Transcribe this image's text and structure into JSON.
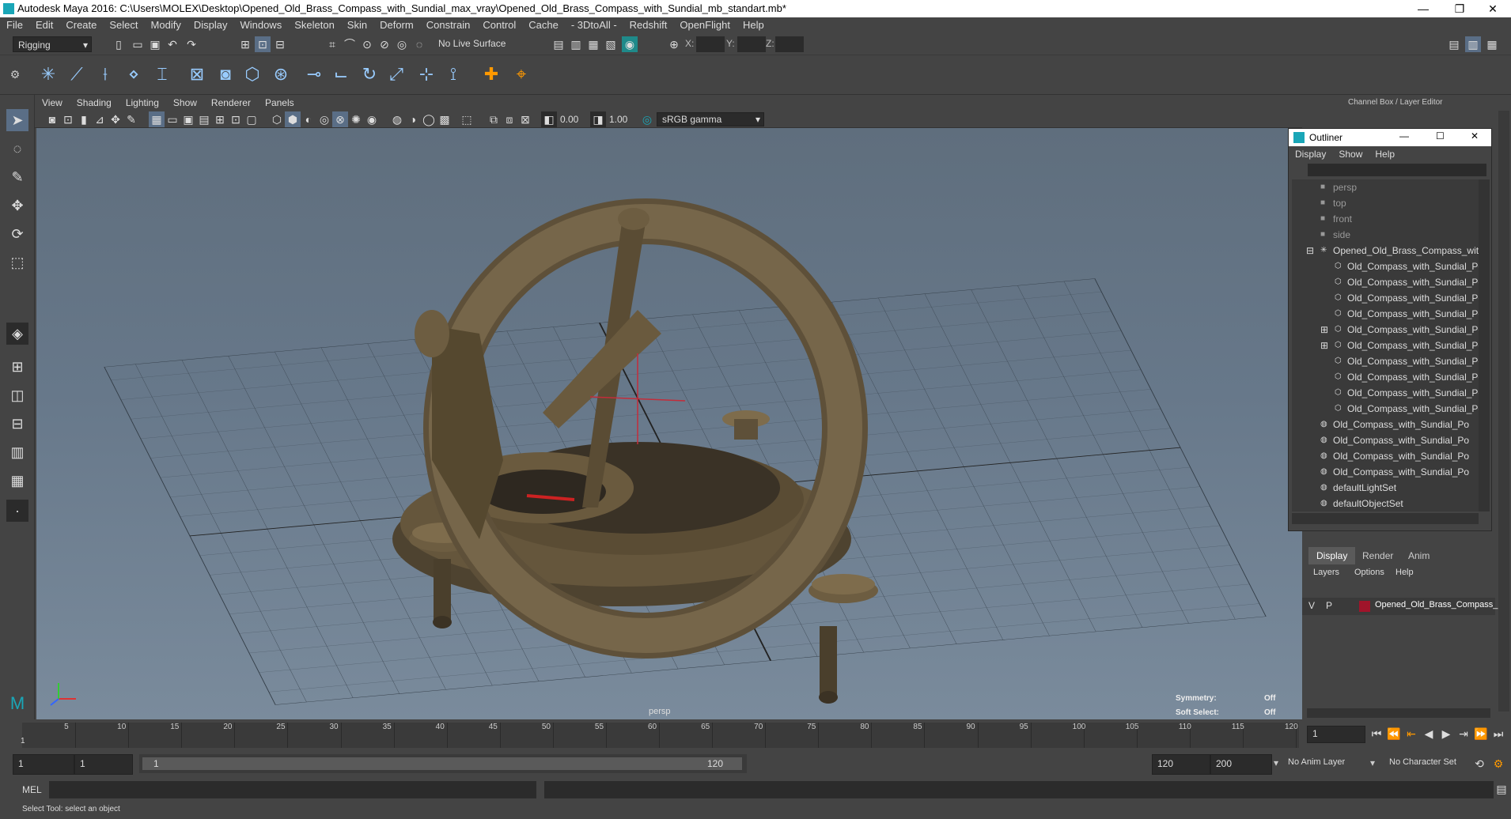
{
  "window": {
    "title": "Autodesk Maya 2016: C:\\Users\\MOLEX\\Desktop\\Opened_Old_Brass_Compass_with_Sundial_max_vray\\Opened_Old_Brass_Compass_with_Sundial_mb_standart.mb*",
    "controls": [
      "—",
      "❐",
      "✕"
    ]
  },
  "menubar": [
    "File",
    "Edit",
    "Create",
    "Select",
    "Modify",
    "Display",
    "Windows",
    "Skeleton",
    "Skin",
    "Deform",
    "Constrain",
    "Control",
    "Cache",
    "- 3DtoAll -",
    "Redshift",
    "OpenFlight",
    "Help"
  ],
  "toolbar": {
    "mode": "Rigging",
    "live_surface": "No Live Surface",
    "x_label": "X:",
    "y_label": "Y:",
    "z_label": "Z:"
  },
  "panel_menu": [
    "View",
    "Shading",
    "Lighting",
    "Show",
    "Renderer",
    "Panels"
  ],
  "panel_tools": {
    "exposure": "0.00",
    "gamma": "1.00",
    "color_space": "sRGB gamma"
  },
  "viewport": {
    "camera": "persp",
    "symmetry_label": "Symmetry:",
    "symmetry_value": "Off",
    "soft_select_label": "Soft Select:",
    "soft_select_value": "Off"
  },
  "channel_box_label": "Channel Box / Layer Editor",
  "outliner": {
    "title": "Outliner",
    "menu": [
      "Display",
      "Show",
      "Help"
    ],
    "items": [
      {
        "label": "persp",
        "dim": true
      },
      {
        "label": "top",
        "dim": true
      },
      {
        "label": "front",
        "dim": true
      },
      {
        "label": "side",
        "dim": true
      },
      {
        "label": "Opened_Old_Brass_Compass_with",
        "dim": false
      },
      {
        "label": "Old_Compass_with_Sundial_Po",
        "dim": false
      },
      {
        "label": "Old_Compass_with_Sundial_Po",
        "dim": false
      },
      {
        "label": "Old_Compass_with_Sundial_Po",
        "dim": false
      },
      {
        "label": "Old_Compass_with_Sundial_Po",
        "dim": false
      },
      {
        "label": "Old_Compass_with_Sundial_Po",
        "dim": false
      },
      {
        "label": "Old_Compass_with_Sundial_Po",
        "dim": false
      },
      {
        "label": "Old_Compass_with_Sundial_Po",
        "dim": false
      },
      {
        "label": "Old_Compass_with_Sundial_Po",
        "dim": false
      },
      {
        "label": "Old_Compass_with_Sundial_Po",
        "dim": false
      },
      {
        "label": "Old_Compass_with_Sundial_Po",
        "dim": false
      },
      {
        "label": "Old_Compass_with_Sundial_Po",
        "dim": false
      },
      {
        "label": "Old_Compass_with_Sundial_Po",
        "dim": false
      },
      {
        "label": "Old_Compass_with_Sundial_Po",
        "dim": false
      },
      {
        "label": "Old_Compass_with_Sundial_Po",
        "dim": false
      },
      {
        "label": "defaultLightSet",
        "dim": false
      },
      {
        "label": "defaultObjectSet",
        "dim": false
      }
    ]
  },
  "layer_editor": {
    "tabs": [
      "Display",
      "Render",
      "Anim"
    ],
    "menu": [
      "Layers",
      "Options",
      "Help"
    ],
    "layer": {
      "v": "V",
      "p": "P",
      "name": "Opened_Old_Brass_Compass_",
      "color": "#a0142a"
    }
  },
  "timeline": {
    "ticks": [
      "5",
      "10",
      "15",
      "20",
      "25",
      "30",
      "35",
      "40",
      "45",
      "50",
      "55",
      "60",
      "65",
      "70",
      "75",
      "80",
      "85",
      "90",
      "95",
      "100",
      "105",
      "110",
      "115",
      "120"
    ],
    "start_marker": "1",
    "current_frame": "1"
  },
  "range": {
    "start": "1",
    "playback_start": "1",
    "slider_start": "1",
    "slider_end": "120",
    "playback_end": "120",
    "end": "200",
    "anim_layer": "No Anim Layer",
    "character_set": "No Character Set"
  },
  "cmdline": {
    "lang": "MEL"
  },
  "helpline": {
    "text": "Select Tool: select an object"
  }
}
